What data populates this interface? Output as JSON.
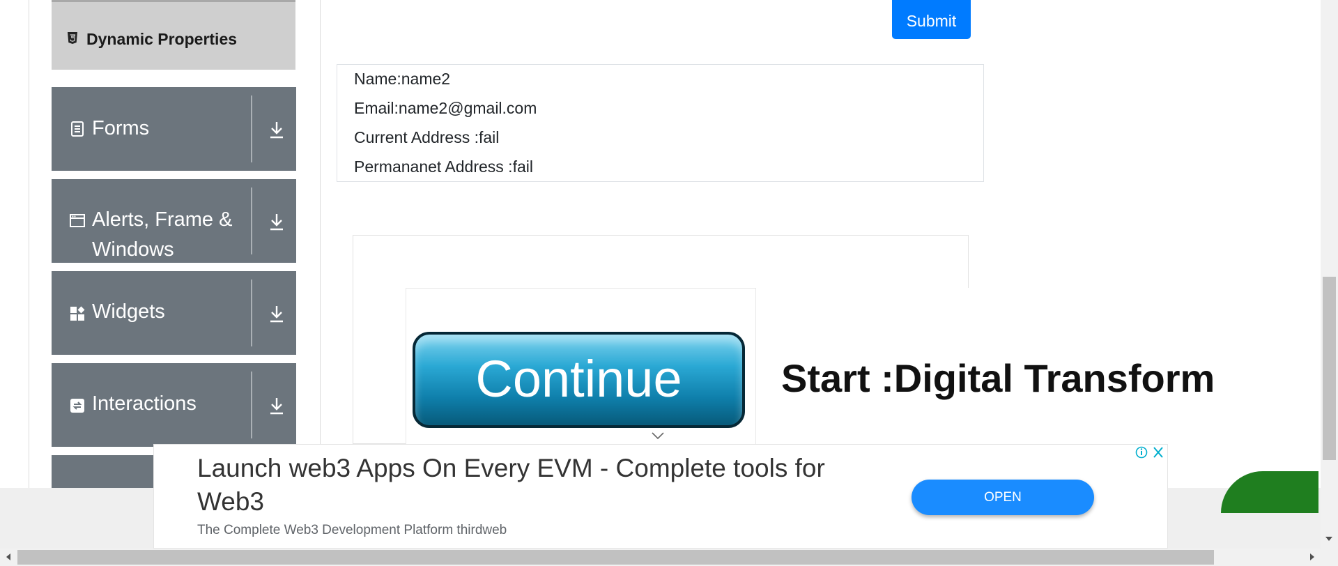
{
  "sidebar": {
    "active_item": {
      "label": "Dynamic Properties",
      "icon": "html5-icon"
    },
    "groups": [
      {
        "label": "Forms",
        "icon": "document-icon",
        "toggle_icon": "download-arrow-icon"
      },
      {
        "label": "Alerts, Frame & Windows",
        "line1": "Alerts, Frame &",
        "line2": "Windows",
        "icon": "window-icon",
        "toggle_icon": "download-arrow-icon"
      },
      {
        "label": "Widgets",
        "icon": "widgets-icon",
        "toggle_icon": "download-arrow-icon"
      },
      {
        "label": "Interactions",
        "icon": "interactions-icon",
        "toggle_icon": "download-arrow-icon"
      }
    ]
  },
  "form": {
    "submit_label": "Submit",
    "output": {
      "name": "Name:name2",
      "email": "Email:name2@gmail.com",
      "current_address": "Current Address :fail",
      "permanent_address": "Permananet Address :fail"
    }
  },
  "ad": {
    "button_text": "Continue",
    "headline_text": "Start :Digital Transform"
  },
  "banner": {
    "headline": "Launch web3 Apps On Every EVM - Complete tools for Web3",
    "subtext": "The Complete Web3 Development Platform thirdweb",
    "cta": "OPEN"
  },
  "colors": {
    "primary": "#007bff",
    "sidebar_group": "#6c757d",
    "active_item": "#cfcfcf",
    "open_button": "#1a8cff"
  }
}
